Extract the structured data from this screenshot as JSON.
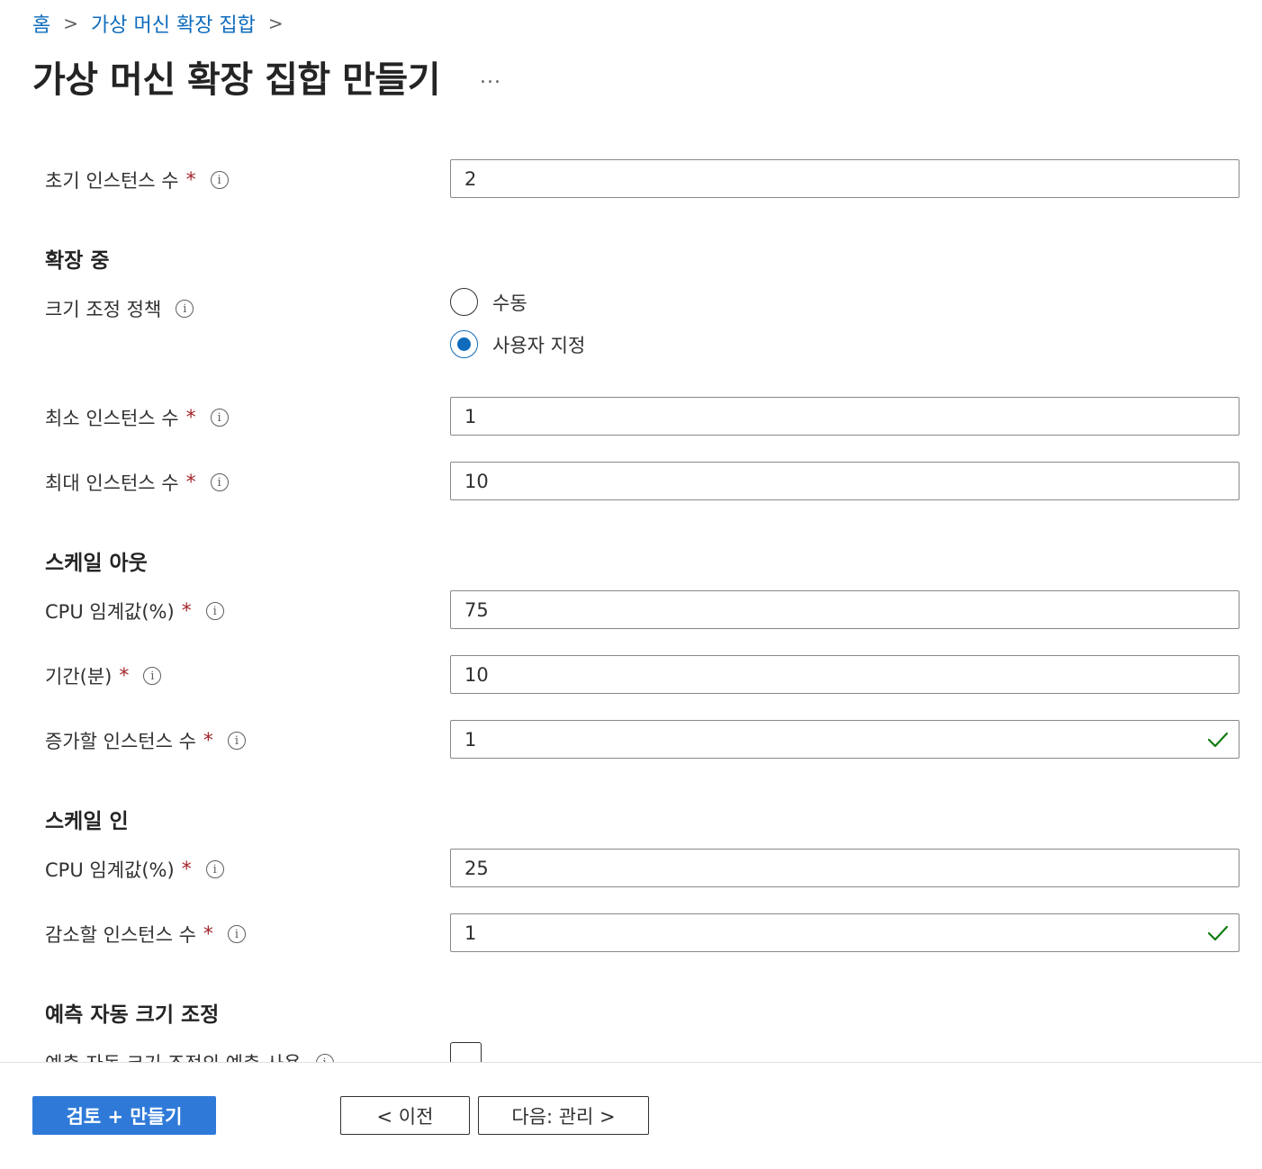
{
  "breadcrumb": {
    "home": "홈",
    "parent": "가상 머신 확장 집합",
    "sep": ">"
  },
  "header": {
    "title": "가상 머신 확장 집합 만들기",
    "more": "..."
  },
  "labels": {
    "initial_instances": "초기 인스턴스 수",
    "scaling_policy": "크기 조정 정책",
    "min_instances": "최소 인스턴스 수",
    "max_instances": "최대 인스턴스 수",
    "cpu_threshold": "CPU 임계값(%)",
    "duration": "기간(분)",
    "increase_instances": "증가할 인스턴스 수",
    "decrease_instances": "감소할 인스턴스 수",
    "predictive_enable": "예측 자동 크기 조정의 예측 사용",
    "required_mark": "*",
    "info_glyph": "i"
  },
  "sections": {
    "scaling": "확장 중",
    "scale_out": "스케일 아웃",
    "scale_in": "스케일 인",
    "predictive": "예측 자동 크기 조정"
  },
  "values": {
    "initial_instances": "2",
    "min_instances": "1",
    "max_instances": "10",
    "scale_out_cpu": "75",
    "scale_out_duration": "10",
    "increase_instances": "1",
    "scale_in_cpu": "25",
    "decrease_instances": "1"
  },
  "scaling_policy": {
    "options": [
      "수동",
      "사용자 지정"
    ],
    "selected": "사용자 지정"
  },
  "predictive_checked": false,
  "footer": {
    "review_create": "검토 + 만들기",
    "previous": "< 이전",
    "next": "다음: 관리 >"
  },
  "colors": {
    "primary": "#2f7ad8",
    "link": "#0f6cbd",
    "required": "#a4262c",
    "valid": "#107c10"
  },
  "icons": {
    "valid": "checkmark-icon",
    "info": "info-icon",
    "more": "more-icon",
    "chevron": "chevron-right-icon"
  }
}
